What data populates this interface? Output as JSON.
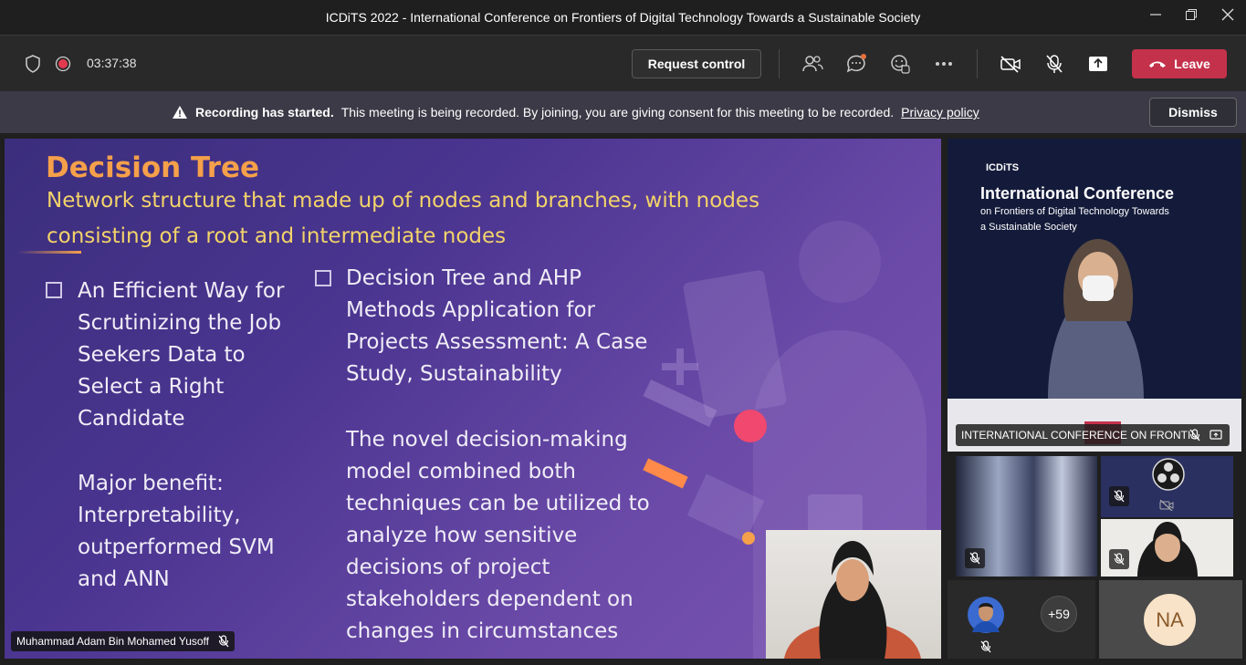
{
  "window": {
    "title": "ICDiTS 2022 - International Conference on Frontiers of Digital Technology Towards a Sustainable Society"
  },
  "toolbar": {
    "timer": "03:37:38",
    "request_control_label": "Request control",
    "leave_label": "Leave",
    "icons": [
      "shield-icon",
      "recording-icon",
      "people-icon",
      "chat-icon",
      "reactions-icon",
      "more-icon",
      "camera-off-icon",
      "mic-off-icon",
      "share-icon",
      "phone-icon"
    ]
  },
  "banner": {
    "bold": "Recording has started.",
    "message": "This meeting is being recorded. By joining, you are giving consent for this meeting to be recorded.",
    "link": "Privacy policy",
    "dismiss_label": "Dismiss"
  },
  "slide": {
    "title": "Decision Tree",
    "subtitle_line1": "Network structure that made up of nodes and branches, with nodes",
    "subtitle_line2": "consisting of a root and intermediate nodes",
    "left_bullet": [
      "An Efficient Way for",
      "Scrutinizing the Job",
      "Seekers Data to",
      "Select a Right",
      "Candidate"
    ],
    "left_note": [
      "Major benefit:",
      "Interpretability,",
      "outperformed SVM",
      "and ANN"
    ],
    "right_bullet": [
      "Decision Tree and AHP",
      "Methods Application for",
      "Projects Assessment: A Case",
      "Study, Sustainability"
    ],
    "right_note": [
      "The novel decision-making",
      "model combined both",
      "techniques can be utilized to",
      "analyze how sensitive",
      "decisions of project",
      "stakeholders dependent on",
      "changes in circumstances"
    ]
  },
  "presenter": {
    "name": "Muhammad Adam Bin Mohamed Yusoff"
  },
  "participants": {
    "conference_label": "INTERNATIONAL CONFERENCE ON FRONTI...",
    "conf_slide_logo": "ICDiTS",
    "conf_slide_title": "International Conference",
    "conf_slide_sub1": "on Frontiers of Digital Technology Towards",
    "conf_slide_sub2": "a Sustainable Society",
    "more_count": "+59",
    "na_initials": "NA"
  },
  "colors": {
    "leave": "#c4314b",
    "record": "#e23b4f",
    "slide_title": "#f5a04a",
    "slide_sub": "#f3d36a"
  }
}
